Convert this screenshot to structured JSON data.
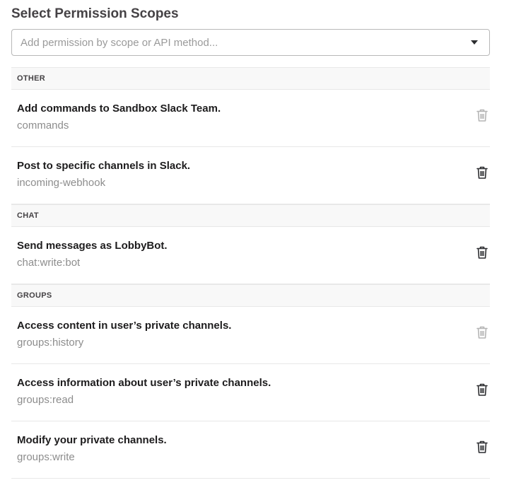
{
  "page": {
    "title": "Select Permission Scopes"
  },
  "search": {
    "placeholder": "Add permission by scope or API method...",
    "value": ""
  },
  "sections": [
    {
      "header": "OTHER",
      "items": [
        {
          "description": "Add commands to Sandbox Slack Team.",
          "scope": "commands",
          "remove_enabled": false,
          "remove_icon": "trash-icon"
        },
        {
          "description": "Post to specific channels in Slack.",
          "scope": "incoming-webhook",
          "remove_enabled": true,
          "remove_icon": "trash-icon"
        }
      ]
    },
    {
      "header": "CHAT",
      "items": [
        {
          "description": "Send messages as LobbyBot.",
          "scope": "chat:write:bot",
          "remove_enabled": true,
          "remove_icon": "trash-icon"
        }
      ]
    },
    {
      "header": "GROUPS",
      "items": [
        {
          "description": "Access content in user’s private channels.",
          "scope": "groups:history",
          "remove_enabled": false,
          "remove_icon": "trash-icon"
        },
        {
          "description": "Access information about user’s private channels.",
          "scope": "groups:read",
          "remove_enabled": true,
          "remove_icon": "trash-icon"
        },
        {
          "description": "Modify your private channels.",
          "scope": "groups:write",
          "remove_enabled": true,
          "remove_icon": "trash-icon"
        }
      ]
    }
  ],
  "colors": {
    "section_bg": "#f8f8f8",
    "divider": "#e8e8e8",
    "scope_text": "#8d8d8d",
    "icon_enabled": "#2c2d30",
    "icon_disabled": "#b5b5b5"
  }
}
